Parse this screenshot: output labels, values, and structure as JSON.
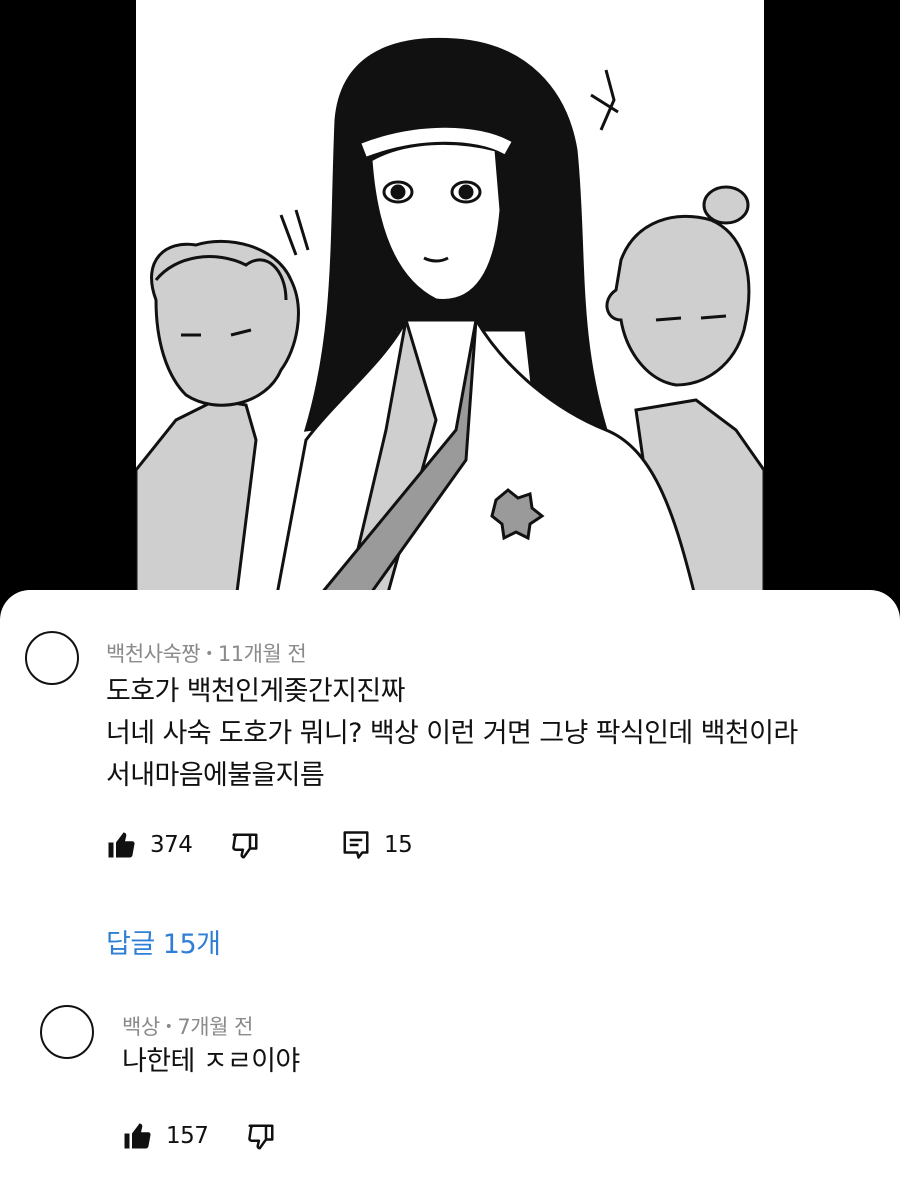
{
  "comment": {
    "author": "백천사숙짱",
    "separator": "•",
    "time": "11개월 전",
    "lines": [
      "도호가 백천인게좆간지진짜",
      "너네 사숙 도호가 뭐니? 백상 이런 거면 그냥 팍식인데 백천이라",
      "서내마음에불을지름"
    ],
    "like_count": "374",
    "reply_count": "15",
    "replies_link": "답글 15개"
  },
  "reply": {
    "author": "백상",
    "separator": "•",
    "time": "7개월 전",
    "text": "나한테 ㅈㄹ이야",
    "like_count": "157"
  },
  "colors": {
    "link": "#2f7fd6",
    "meta": "#8a8a8a",
    "text": "#111111",
    "background": "#000000"
  },
  "icons": [
    "thumbs-up-filled-icon",
    "thumbs-down-outline-icon",
    "comment-icon"
  ]
}
